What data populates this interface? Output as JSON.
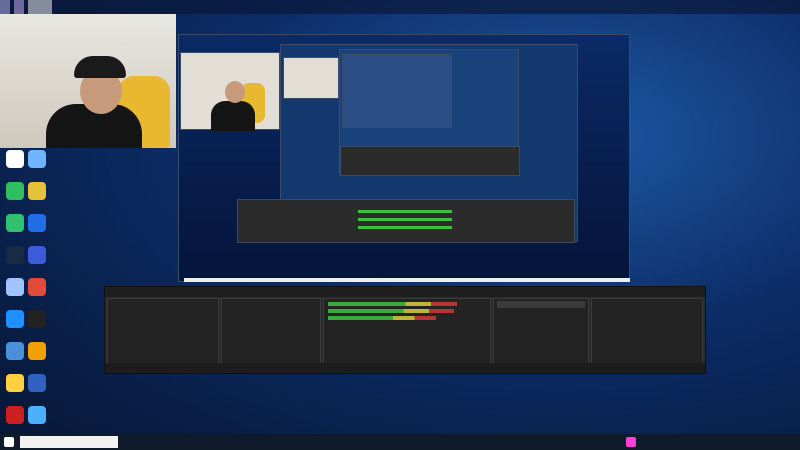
{
  "overlay": {
    "top_marquee": "",
    "recent_donor": "",
    "recent_donor_small": "",
    "qq_group_mid": "",
    "qq_group_bottom": ""
  },
  "obs": {
    "window_title": "",
    "panels": {
      "scenes": "",
      "sources": "",
      "mixer": "",
      "transitions": "",
      "controls": ""
    },
    "sources": [],
    "mixer_channels": [
      {
        "db": "",
        "level": 0.86
      },
      {
        "db": "",
        "level": 0.84
      },
      {
        "db": "",
        "level": 0.72
      }
    ],
    "transition": {
      "type": "",
      "duration_label": "",
      "duration_value": ""
    },
    "controls": [],
    "statusbar": ""
  },
  "desktop_icons": [
    {
      "color": "#ffffff"
    },
    {
      "color": "#6fb5ff"
    },
    {
      "color": "#2fbf5f"
    },
    {
      "color": "#e6c23a"
    },
    {
      "color": "#30c070"
    },
    {
      "color": "#1f6ee6"
    },
    {
      "color": "#1a2a44"
    },
    {
      "color": "#3b5bdb"
    },
    {
      "color": "#a0c4ff"
    },
    {
      "color": "#e04a3a"
    },
    {
      "color": "#1e90ff"
    },
    {
      "color": "#222222"
    },
    {
      "color": "#4a90d9"
    },
    {
      "color": "#f0a000"
    },
    {
      "color": "#ffd040"
    },
    {
      "color": "#3060c0"
    },
    {
      "color": "#cc2020"
    },
    {
      "color": "#4db0ff"
    }
  ],
  "taskbar": {
    "search_placeholder": "",
    "weather": "",
    "clock_time": "",
    "clock_date": ""
  },
  "colors": {
    "overlay_magenta": "#ff3fd8",
    "obs_bg": "#2b2b2b",
    "taskbar_bg": "#0f1a2a"
  }
}
